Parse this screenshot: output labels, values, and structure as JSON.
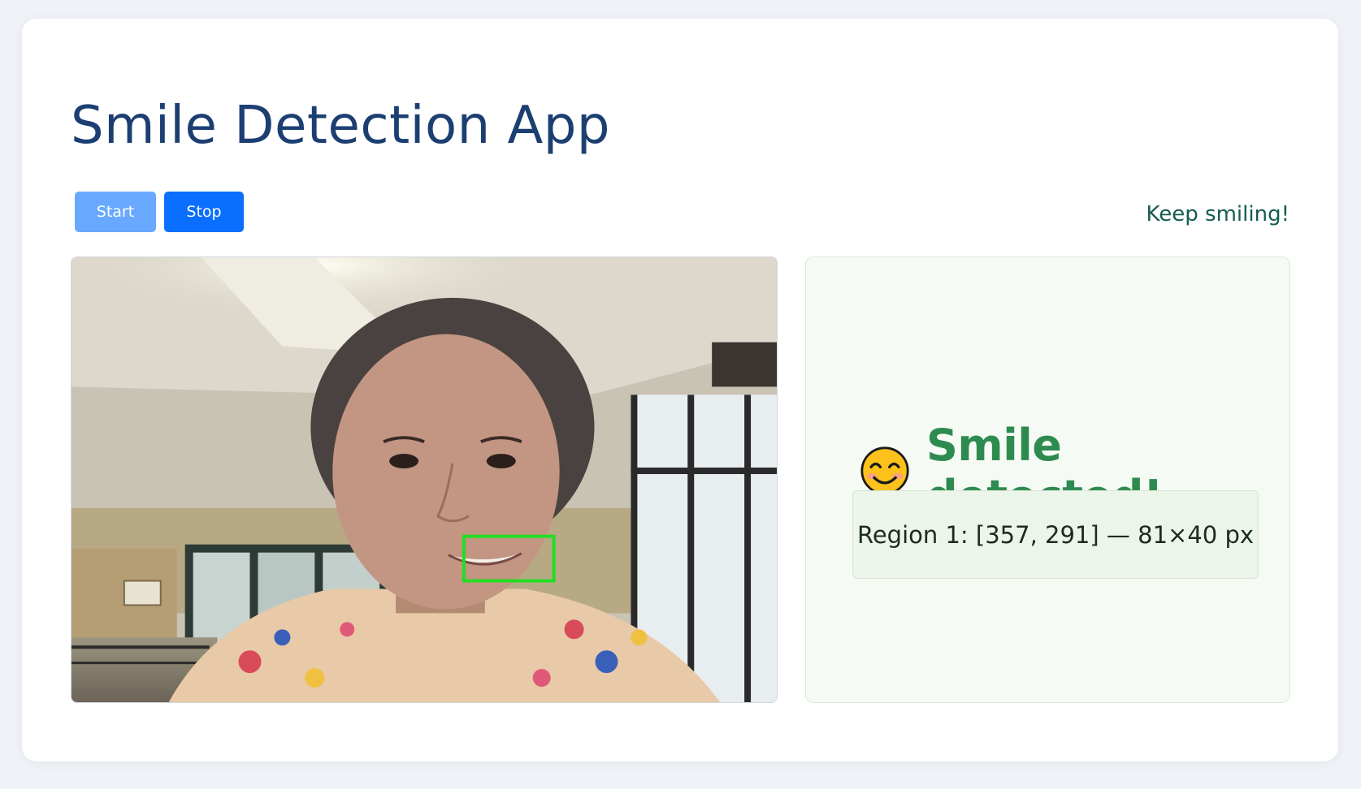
{
  "app": {
    "title": "Smile Detection App",
    "status_message": "Keep smiling!"
  },
  "controls": {
    "start_label": "Start",
    "stop_label": "Stop"
  },
  "result": {
    "icon": "smiling-face-icon",
    "heading": "Smile detected!",
    "regions": [
      "Region 1: [357, 291] — 81×40 px"
    ]
  },
  "colors": {
    "title": "#1c3f72",
    "start_button": "#68a9ff",
    "stop_button": "#0a6fff",
    "status_text": "#155c52",
    "detected_text": "#2e8b50",
    "detection_box": "#22dd22"
  }
}
